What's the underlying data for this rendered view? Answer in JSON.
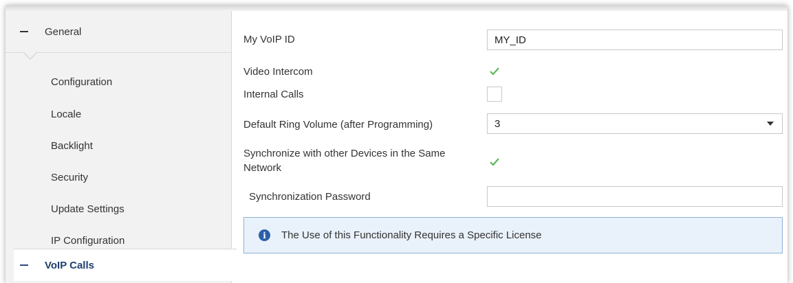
{
  "sidebar": {
    "group_label": "General",
    "items": [
      {
        "label": "Configuration"
      },
      {
        "label": "Locale"
      },
      {
        "label": "Backlight"
      },
      {
        "label": "Security"
      },
      {
        "label": "Update Settings"
      },
      {
        "label": "IP Configuration"
      }
    ],
    "active_group": "VoIP Calls"
  },
  "main": {
    "voip_id_label": "My VoIP ID",
    "voip_id_value": "MY_ID",
    "video_intercom_label": "Video Intercom",
    "video_intercom_checked": true,
    "internal_calls_label": "Internal Calls",
    "internal_calls_checked": false,
    "ring_volume_label": "Default Ring Volume (after Programming)",
    "ring_volume_value": "3",
    "sync_label_line1": "Synchronize with other Devices in the Same",
    "sync_label_line2": "Network",
    "sync_checked": true,
    "sync_password_label": "Synchronization Password",
    "sync_password_value": "",
    "info_text": "The Use of this Functionality Requires a Specific License"
  },
  "colors": {
    "accent": "#1f3f6e",
    "check": "#5cb85c",
    "info_bg": "#e9f1fa",
    "info_border": "#8fb0d6",
    "info_icon": "#2b5fa8"
  },
  "icons": {
    "collapse": "minus-icon",
    "check": "checkmark-icon",
    "dropdown": "chevron-down-icon",
    "info": "info-icon"
  }
}
